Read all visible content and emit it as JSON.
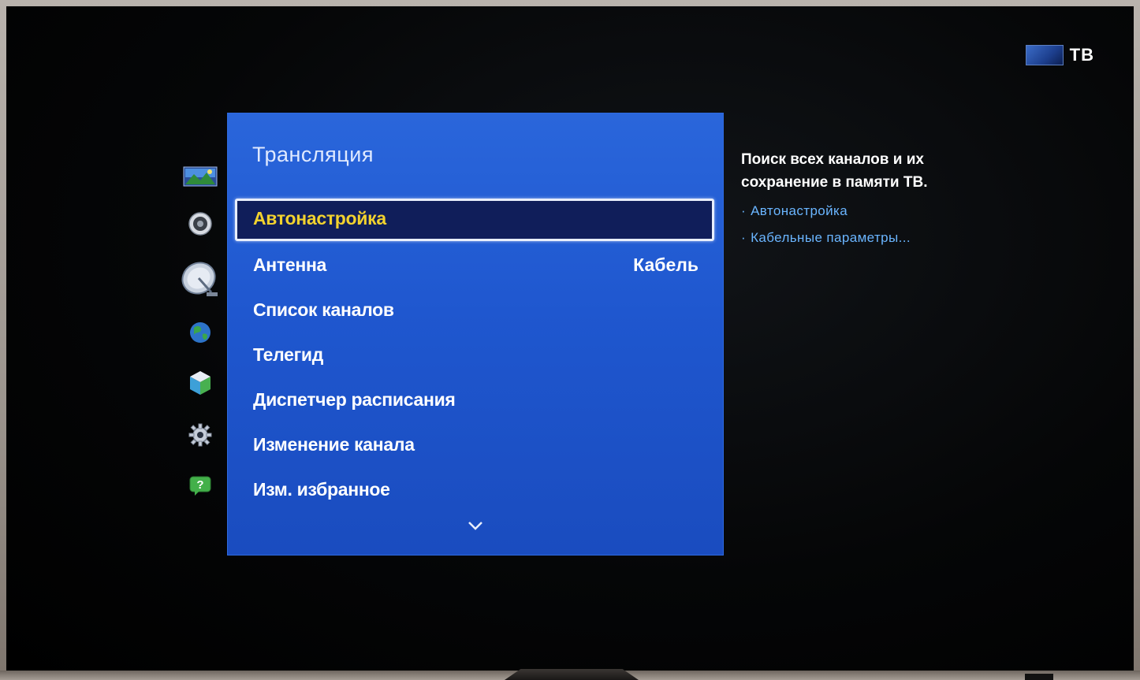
{
  "source": {
    "label": "ТВ",
    "icon": "tv-source-swatch"
  },
  "sidebar": {
    "icons": [
      {
        "name": "picture-icon",
        "selected": false
      },
      {
        "name": "sound-icon",
        "selected": false
      },
      {
        "name": "broadcast-icon",
        "selected": true
      },
      {
        "name": "network-icon",
        "selected": false
      },
      {
        "name": "system-icon",
        "selected": false
      },
      {
        "name": "support-icon",
        "selected": false
      },
      {
        "name": "help-icon",
        "selected": false
      }
    ]
  },
  "panel": {
    "title": "Трансляция",
    "items": [
      {
        "label": "Автонастройка",
        "value": "",
        "selected": true
      },
      {
        "label": "Антенна",
        "value": "Кабель",
        "selected": false
      },
      {
        "label": "Список каналов",
        "value": "",
        "selected": false
      },
      {
        "label": "Телегид",
        "value": "",
        "selected": false
      },
      {
        "label": "Диспетчер расписания",
        "value": "",
        "selected": false
      },
      {
        "label": "Изменение канала",
        "value": "",
        "selected": false
      },
      {
        "label": "Изм. избранное",
        "value": "",
        "selected": false
      }
    ],
    "more_icon": "chevron-down-icon"
  },
  "help": {
    "description": "Поиск всех каналов и их сохранение в памяти ТВ.",
    "links": [
      "Автонастройка",
      "Кабельные параметры..."
    ]
  },
  "colors": {
    "panel_blue": "#1f57cf",
    "selected_bg": "#101e5a",
    "selected_text": "#f2d22e",
    "link_blue": "#6ab5ff"
  }
}
